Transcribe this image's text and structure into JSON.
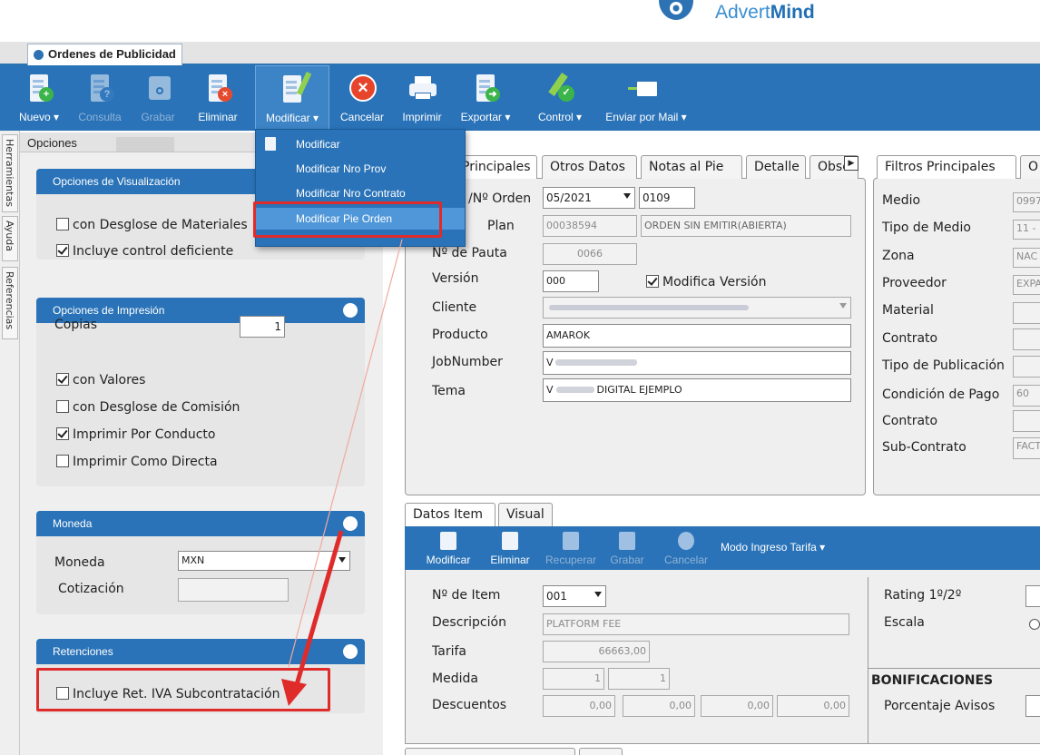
{
  "brand": {
    "name_part1": "Advert",
    "name_part2": "Mind"
  },
  "window_tab": {
    "title": "Ordenes de Publicidad"
  },
  "toolbar": {
    "nuevo": "Nuevo ▾",
    "consulta": "Consulta",
    "grabar": "Grabar",
    "eliminar": "Eliminar",
    "modificar": "Modificar ▾",
    "cancelar": "Cancelar",
    "imprimir": "Imprimir",
    "exportar": "Exportar ▾",
    "control": "Control ▾",
    "enviar": "Enviar por Mail ▾"
  },
  "modificar_menu": {
    "items": [
      "Modificar",
      "Modificar Nro Prov",
      "Modificar Nro Contrato",
      "Modificar Pie Orden"
    ],
    "highlighted": "Modificar Pie Orden"
  },
  "side_tabs": [
    "Herramientas",
    "Ayuda",
    "Referencias"
  ],
  "opciones": {
    "header": "Opciones"
  },
  "vis": {
    "title": "Opciones de Visualización",
    "desglose_materiales": "con Desglose de Materiales",
    "control_deficiente": "Incluye control deficiente"
  },
  "imp": {
    "title": "Opciones de Impresión",
    "copias_label": "Copias",
    "copias_value": "1",
    "con_valores": "con Valores",
    "desglose_comision": "con Desglose de Comisión",
    "por_conducto": "Imprimir Por Conducto",
    "como_directa": "Imprimir Como Directa"
  },
  "moneda": {
    "title": "Moneda",
    "moneda_label": "Moneda",
    "moneda_value": "MXN",
    "cotizacion_label": "Cotización",
    "cotizacion_value": ""
  },
  "ret": {
    "title": "Retenciones",
    "iva_sub": "Incluye Ret. IVA Subcontratación"
  },
  "order_tabs": [
    "Principales",
    "Otros Datos",
    "Notas al Pie",
    "Detalle",
    "Obse"
  ],
  "order": {
    "periodo_label": "/Nº Orden",
    "periodo_value": "05/2021",
    "orden_value": "0109",
    "plan_label": "Plan",
    "plan_value": "00038594",
    "estado_value": "ORDEN SIN EMITIR(ABIERTA)",
    "pauta_label": "Nº de Pauta",
    "pauta_value": "0066",
    "version_label": "Versión",
    "version_value": "000",
    "modifica_version": "Modifica Versión",
    "cliente_label": "Cliente",
    "producto_label": "Producto",
    "producto_value": "AMAROK",
    "jobnumber_label": "JobNumber",
    "jobnumber_value": "V",
    "tema_label": "Tema",
    "tema_prefix": "V",
    "tema_value": "DIGITAL EJEMPLO"
  },
  "filtros": {
    "tab1": "Filtros Principales",
    "tab2": "O",
    "medio": "Medio",
    "medio_value": "0997",
    "tipo_medio": "Tipo de Medio",
    "tipo_medio_value": "11 -",
    "zona": "Zona",
    "zona_value": "NAC",
    "proveedor": "Proveedor",
    "proveedor_value": "EXPA",
    "material": "Material",
    "contrato": "Contrato",
    "tipo_publicacion": "Tipo de Publicación",
    "condicion_pago": "Condición de Pago",
    "condicion_pago_value": "60",
    "contrato2": "Contrato",
    "subcontrato": "Sub-Contrato",
    "subcontrato_value": "FACT"
  },
  "item_tabs": [
    "Datos Item",
    "Visual"
  ],
  "item_toolbar": {
    "modificar": "Modificar",
    "eliminar": "Eliminar",
    "recuperar": "Recuperar",
    "grabar": "Grabar",
    "cancelar": "Cancelar",
    "modo": "Modo Ingreso Tarifa ▾"
  },
  "item": {
    "nro_label": "Nº de Item",
    "nro_value": "001",
    "desc_label": "Descripción",
    "desc_value": "PLATFORM FEE",
    "tarifa_label": "Tarifa",
    "tarifa_value": "66663,00",
    "medida_label": "Medida",
    "medida1": "1",
    "medida2": "1",
    "desc2_label": "Descuentos",
    "d1": "0,00",
    "d2": "0,00",
    "d3": "0,00",
    "d4": "0,00",
    "rating_label": "Rating 1º/2º",
    "escala_label": "Escala",
    "bonif_title": "BONIFICACIONES",
    "porc_avisos": "Porcentaje Avisos"
  }
}
